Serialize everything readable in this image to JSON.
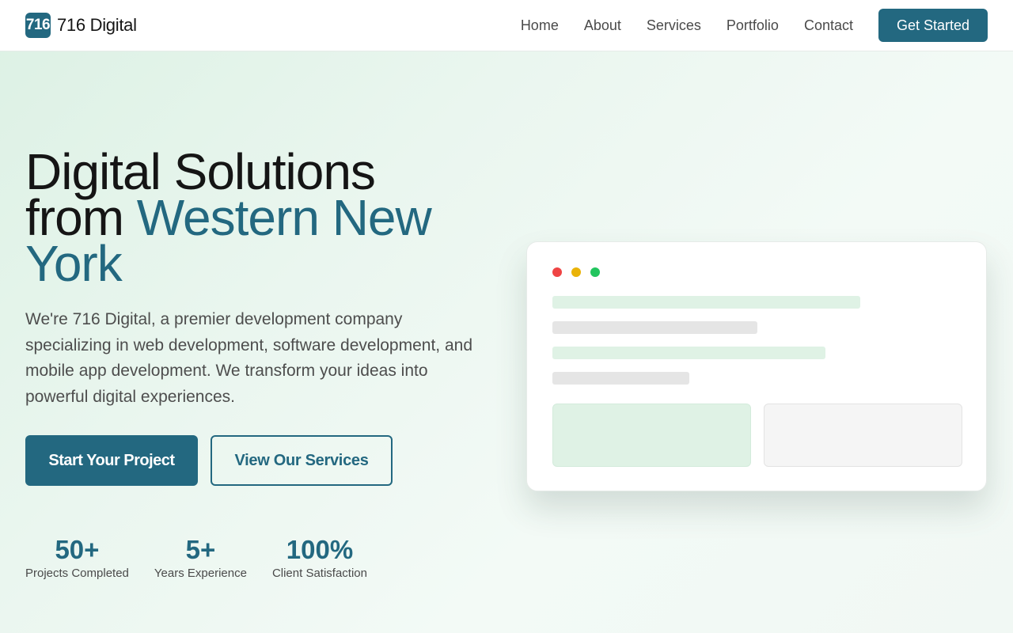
{
  "brand": {
    "mark": "716",
    "name": "716 Digital"
  },
  "nav": {
    "links": [
      "Home",
      "About",
      "Services",
      "Portfolio",
      "Contact"
    ],
    "cta": "Get Started"
  },
  "hero": {
    "title_line1": "Digital Solutions",
    "title_line2_plain": "from ",
    "title_accent": "Western New York",
    "description": "We're 716 Digital, a premier development company specializing in web development, software development, and mobile app development. We transform your ideas into powerful digital experiences.",
    "primary_button": "Start Your Project",
    "secondary_button": "View Our Services"
  },
  "stats": [
    {
      "value": "50+",
      "label": "Projects Completed"
    },
    {
      "value": "5+",
      "label": "Years Experience"
    },
    {
      "value": "100%",
      "label": "Client Satisfaction"
    }
  ],
  "colors": {
    "accent": "#236880",
    "window_dot_red": "#ef4444",
    "window_dot_yellow": "#eab308",
    "window_dot_green": "#22c55e",
    "mock_green": "#dff2e5",
    "mock_gray": "#e5e5e5"
  }
}
